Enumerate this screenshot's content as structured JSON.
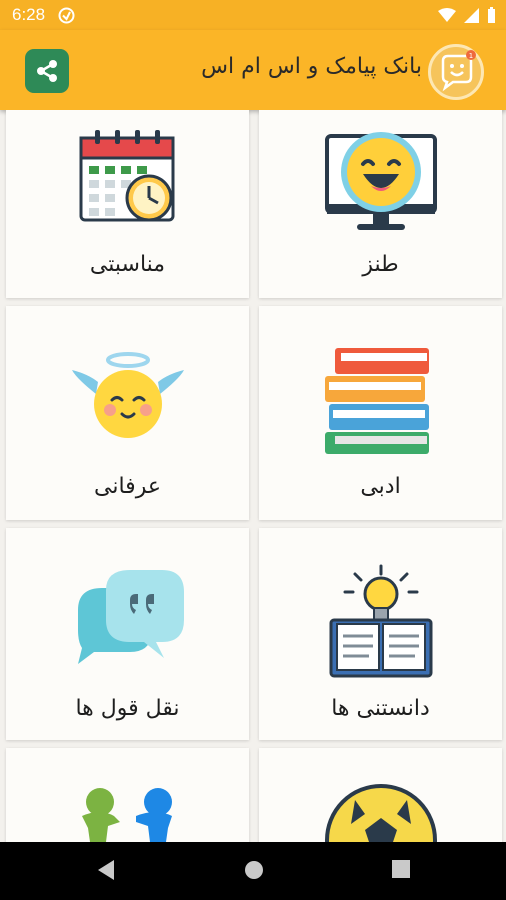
{
  "status": {
    "time": "6:28"
  },
  "header": {
    "title": "بانک پیامک و اس ام اس"
  },
  "categories": [
    {
      "label": "طنز"
    },
    {
      "label": "مناسبتی"
    },
    {
      "label": "ادبی"
    },
    {
      "label": "عرفانی"
    },
    {
      "label": "دانستنی ها"
    },
    {
      "label": "نقل قول ها"
    },
    {
      "label": ""
    },
    {
      "label": ""
    }
  ],
  "colors": {
    "appbar": "#fbb527",
    "statusbar": "#f7b125",
    "share": "#2e8a57"
  }
}
